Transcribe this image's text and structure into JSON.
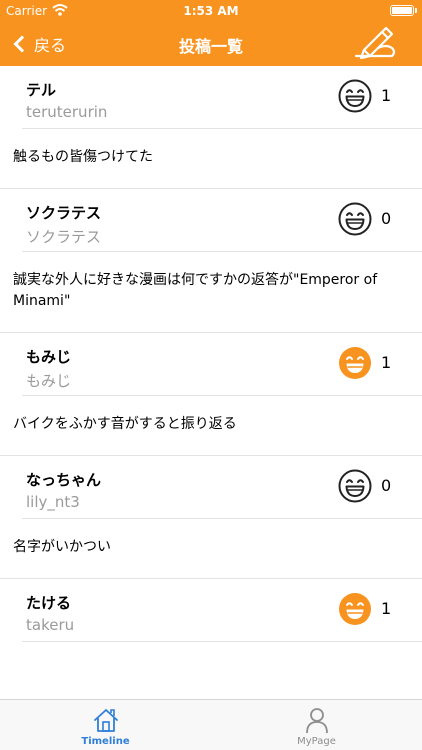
{
  "status_bar": {
    "carrier": "Carrier",
    "time": "1:53 AM"
  },
  "nav": {
    "back_label": "戻る",
    "title": "投稿一覧",
    "compose_icon": "pen-hand-icon"
  },
  "colors": {
    "accent": "#F7931E",
    "tab_active": "#2f7fd8",
    "tab_inactive": "#8e8e8e"
  },
  "posts": [
    {
      "name": "テル",
      "user_id": "teruterurin",
      "likes": "1",
      "liked": false,
      "text": "触るもの皆傷つけてた"
    },
    {
      "name": "ソクラテス",
      "user_id": "ソクラテス",
      "likes": "0",
      "liked": false,
      "text": "誠実な外人に好きな漫画は何ですかの返答が\"Emperor of Minami\""
    },
    {
      "name": "もみじ",
      "user_id": "もみじ",
      "likes": "1",
      "liked": true,
      "text": "バイクをふかす音がすると振り返る"
    },
    {
      "name": "なっちゃん",
      "user_id": "lily_nt3",
      "likes": "0",
      "liked": false,
      "text": "名字がいかつい"
    },
    {
      "name": "たける",
      "user_id": "takeru",
      "likes": "1",
      "liked": true,
      "text": ""
    }
  ],
  "tabbar": {
    "tabs": [
      {
        "label": "Timeline",
        "icon": "home-icon",
        "selected": true
      },
      {
        "label": "MyPage",
        "icon": "person-icon",
        "selected": false
      }
    ]
  }
}
